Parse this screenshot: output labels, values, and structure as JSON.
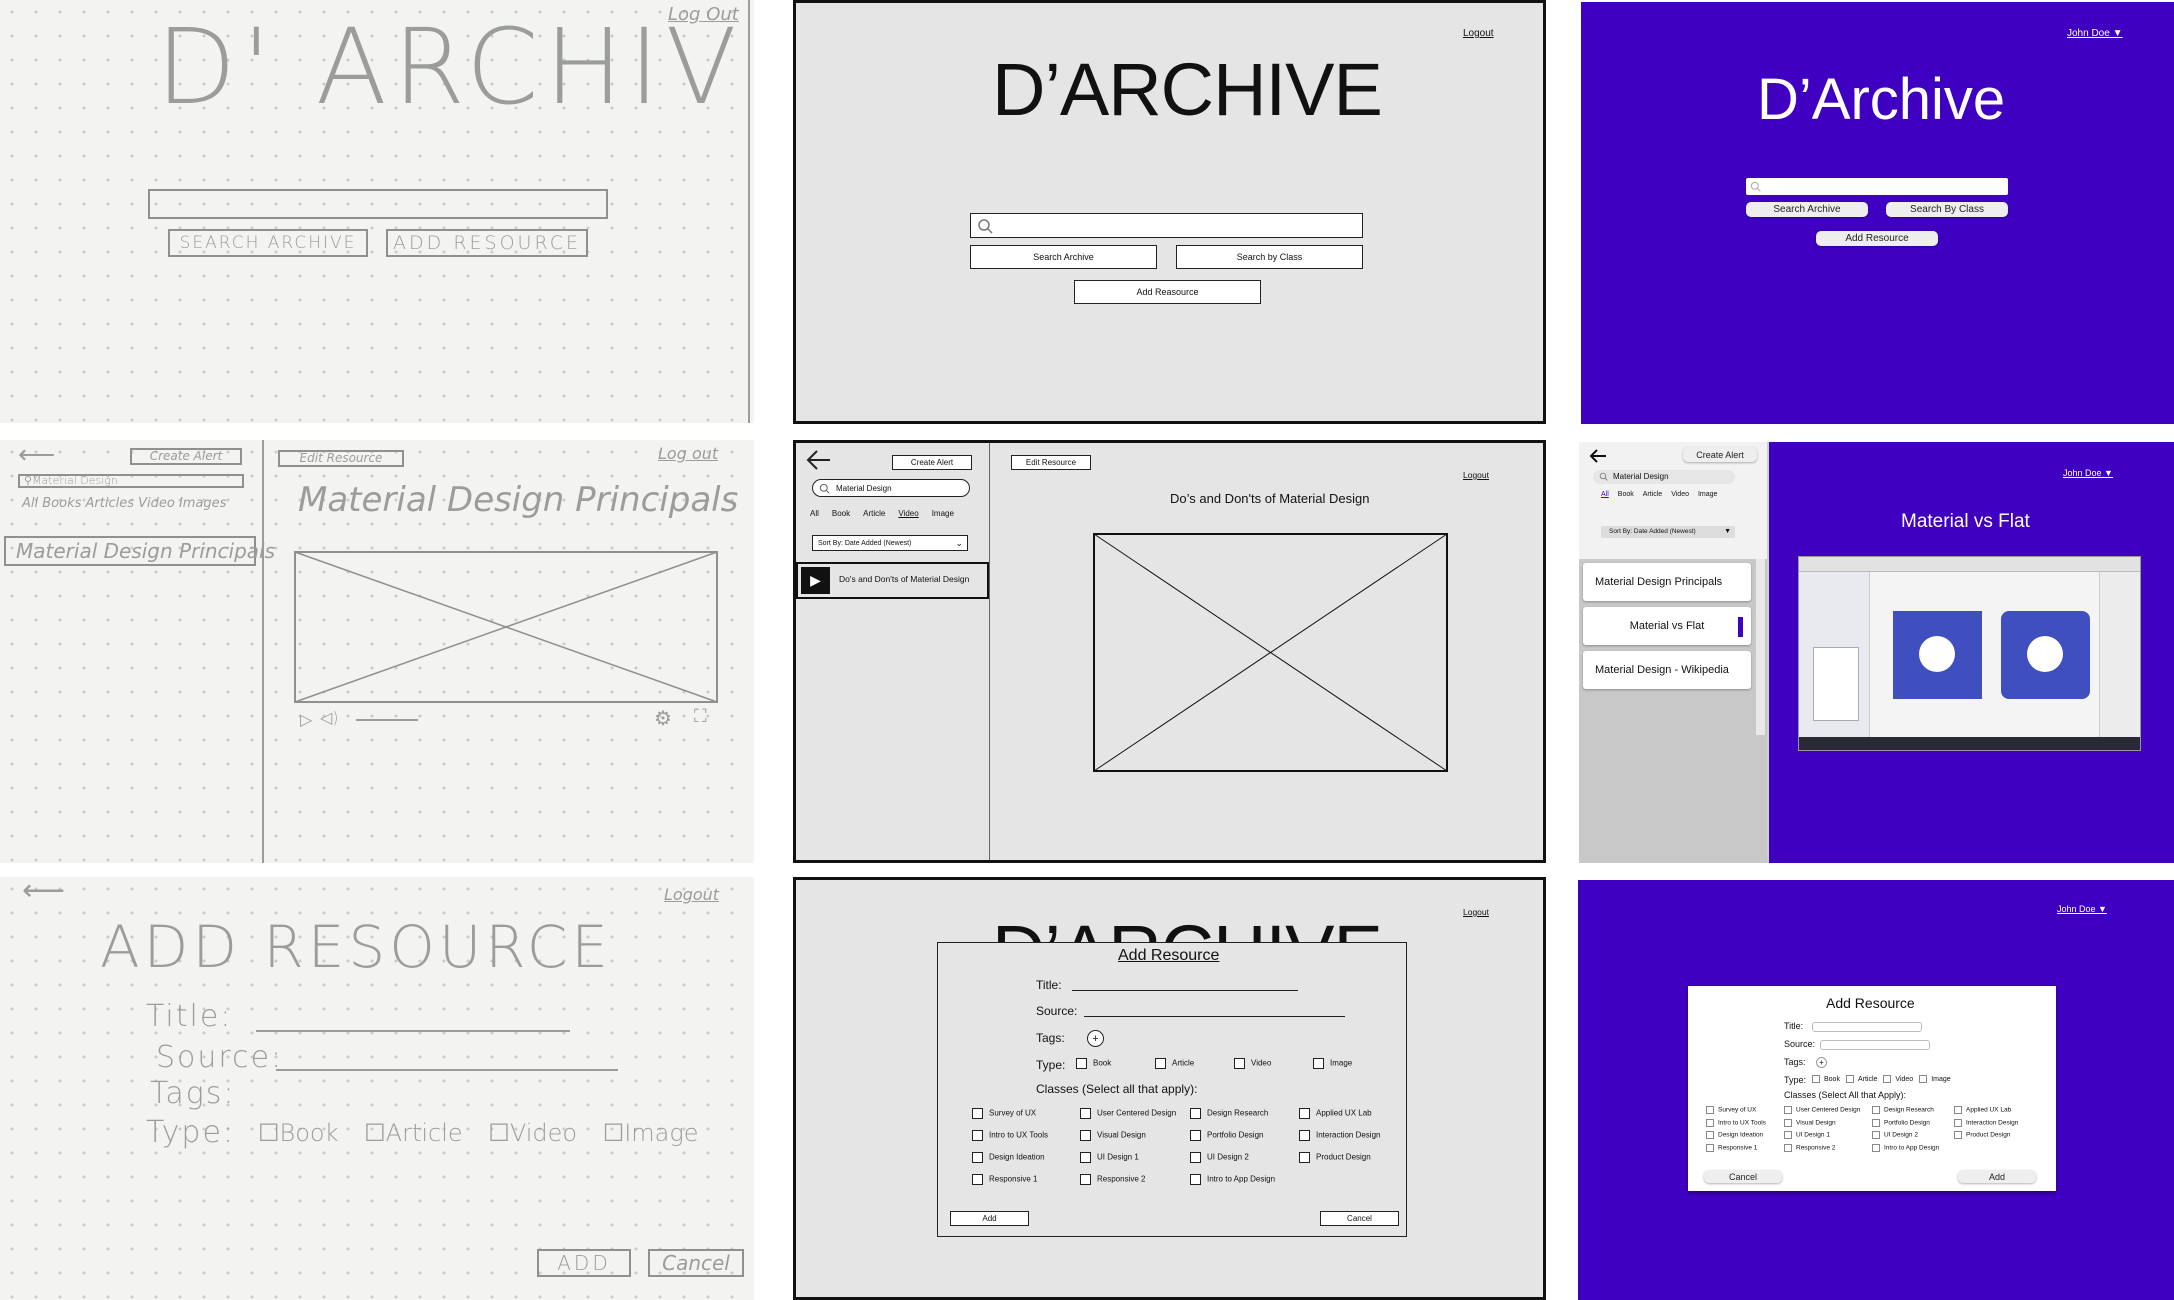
{
  "sketch_home": {
    "logout": "Log Out",
    "title": "D' ARCHIVE",
    "search_button": "SEARCH ARCHIVE",
    "add_button": "ADD RESOURCE"
  },
  "wire_home": {
    "logout": "Logout",
    "title": "D’ARCHIVE",
    "search_button": "Search Archive",
    "class_button": "Search by Class",
    "add_button": "Add Reasource"
  },
  "hifi_home": {
    "user": "John Doe",
    "title": "D’Archive",
    "search_button": "Search Archive",
    "class_button": "Search By Class",
    "add_button": "Add Resource"
  },
  "sketch_detail": {
    "create_alert": "Create Alert",
    "search_value": "Material Design",
    "filters": "All Books Articles Video Images",
    "result_item": "Material Design Principals",
    "edit_button": "Edit Resource",
    "logout": "Log out",
    "title": "Material Design Principals"
  },
  "wire_detail": {
    "create_alert": "Create Alert",
    "search_value": "Material Design",
    "filters": [
      "All",
      "Book",
      "Article",
      "Video",
      "Image"
    ],
    "sort": "Sort By: Date Added (Newest)",
    "result_item": "Do's and Don'ts of Material Design",
    "edit_button": "Edit Resource",
    "logout": "Logout",
    "title": "Do’s and Don'ts of Material Design"
  },
  "hifi_detail": {
    "create_alert": "Create Alert",
    "search_value": "Material Design",
    "filters": [
      "All",
      "Book",
      "Article",
      "Video",
      "Image"
    ],
    "sort": "Sort By: Date Added (Newest)",
    "results": [
      "Material Design Principals",
      "Material vs Flat",
      "Material Design - Wikipedia"
    ],
    "user": "John Doe",
    "title": "Material vs Flat"
  },
  "sketch_add": {
    "logout": "Logout",
    "title": "ADD RESOURCE",
    "title_label": "Title:",
    "source_label": "Source:",
    "tags_label": "Tags:",
    "type_label": "Type:",
    "types": [
      "Book",
      "Article",
      "Video",
      "Image"
    ],
    "add_button": "ADD",
    "cancel_button": "Cancel"
  },
  "wire_add": {
    "logout": "Logout",
    "bg_title": "D’ARCHIVE",
    "dialog_title": "Add Resource",
    "title_label": "Title:",
    "source_label": "Source:",
    "tags_label": "Tags:",
    "type_label": "Type:",
    "types": [
      "Book",
      "Article",
      "Video",
      "Image"
    ],
    "classes_label": "Classes (Select all that apply):",
    "classes": [
      [
        "Survey of UX",
        "User Centered Design",
        "Design Research",
        "Applied UX Lab"
      ],
      [
        "Intro to UX Tools",
        "Visual Design",
        "Portfolio Design",
        "Interaction Design"
      ],
      [
        "Design Ideation",
        "UI Design 1",
        "UI Design 2",
        "Product Design"
      ],
      [
        "Responsive 1",
        "Responsive 2",
        "Intro to App Design",
        ""
      ]
    ],
    "add_button": "Add",
    "cancel_button": "Cancel"
  },
  "hifi_add": {
    "user": "John Doe",
    "dialog_title": "Add Resource",
    "title_label": "Title:",
    "source_label": "Source:",
    "tags_label": "Tags:",
    "type_label": "Type:",
    "types": [
      "Book",
      "Article",
      "Video",
      "Image"
    ],
    "classes_label": "Classes (Select All that Apply):",
    "classes": [
      [
        "Survey of UX",
        "User Centered Design",
        "Design Research",
        "Applied UX Lab"
      ],
      [
        "Intro to UX Tools",
        "Visual Design",
        "Portfolio Design",
        "Interaction Design"
      ],
      [
        "Design Ideation",
        "UI Design 1",
        "UI Design 2",
        "Product Design"
      ],
      [
        "Responsive 1",
        "Responsive 2",
        "Intro to App Design",
        ""
      ]
    ],
    "cancel_button": "Cancel",
    "add_button": "Add"
  },
  "colors": {
    "hifi_bg": "#3f00c2",
    "wire_bg": "#e5e5e5",
    "sketch_bg": "#f3f4f1"
  }
}
